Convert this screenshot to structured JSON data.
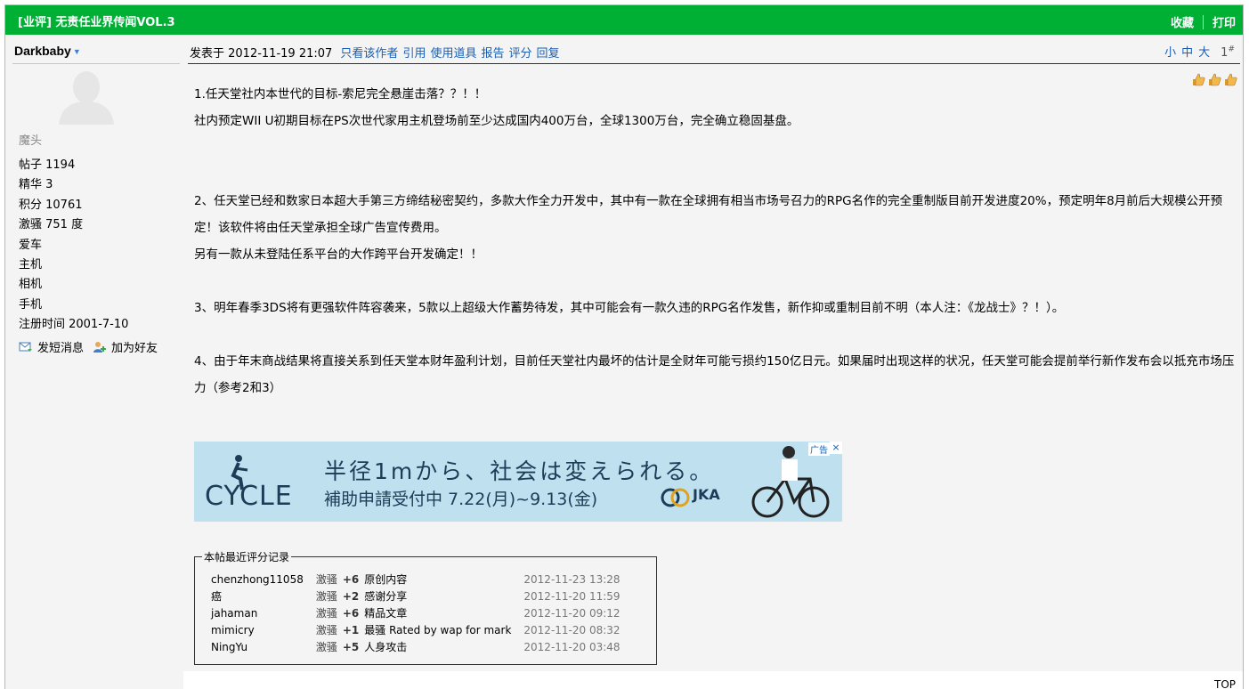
{
  "header": {
    "title": "[业评] 无责任业界传闻VOL.3",
    "favorite": "收藏",
    "print": "打印"
  },
  "author": {
    "name": "Darkbaby",
    "rank": "魔头",
    "stats": [
      "帖子 1194",
      "精华 3",
      "积分 10761",
      "激骚 751 度",
      "爱车",
      "主机",
      "相机",
      "手机",
      "注册时间 2001-7-10"
    ],
    "send_message": "发短消息",
    "add_friend": "加为好友"
  },
  "post_meta": {
    "posted": "发表于 2012-11-19 21:07",
    "links": [
      "只看该作者",
      "引用",
      "使用道具",
      "报告",
      "评分",
      "回复"
    ],
    "font_sizes": [
      "小",
      "中",
      "大"
    ],
    "floor": "1",
    "floor_mark": "#"
  },
  "post_body": [
    "1.任天堂社内本世代的目标-索尼完全悬崖击落？？！！",
    "社内预定WII U初期目标在PS次世代家用主机登场前至少达成国内400万台，全球1300万台，完全确立稳固基盘。",
    "",
    "",
    "2、任天堂已经和数家日本超大手第三方缔结秘密契约，多款大作全力开发中，其中有一款在全球拥有相当市场号召力的RPG名作的完全重制版目前开发进度20%，预定明年8月前后大规模公开预定！该软件将由任天堂承担全球广告宣传费用。",
    "另有一款从未登陆任系平台的大作跨平台开发确定！！",
    "",
    "3、明年春季3DS将有更强软件阵容袭来，5款以上超级大作蓄势待发，其中可能会有一款久违的RPG名作发售，新作抑或重制目前不明（本人注：《龙战士》？！）。",
    "",
    "4、由于年末商战结果将直接关系到任天堂本财年盈利计划，目前任天堂社内最坏的估计是全财年可能亏损约150亿日元。如果届时出现这样的状况，任天堂可能会提前举行新作发布会以抵充市场压力（参考2和3）"
  ],
  "ad": {
    "line1": "半径1mから、社会は変えられる。",
    "line2": "補助申請受付中 7.22(月)~9.13(金)",
    "brand": "CYCLE",
    "logo": "JKA",
    "label": "广告",
    "close": "×"
  },
  "ratings": {
    "legend": "本帖最近评分记录",
    "rows": [
      {
        "user": "chenzhong11058",
        "cat": "激骚",
        "val": "+6",
        "reason": "原创内容",
        "time": "2012-11-23 13:28"
      },
      {
        "user": "癌",
        "cat": "激骚",
        "val": "+2",
        "reason": "感谢分享",
        "time": "2012-11-20 11:59"
      },
      {
        "user": "jahaman",
        "cat": "激骚",
        "val": "+6",
        "reason": "精品文章",
        "time": "2012-11-20 09:12"
      },
      {
        "user": "mimicry",
        "cat": "激骚",
        "val": "+1",
        "reason": "最骚 Rated by wap for mark",
        "time": "2012-11-20 08:32"
      },
      {
        "user": "NingYu",
        "cat": "激骚",
        "val": "+5",
        "reason": "人身攻击",
        "time": "2012-11-20 03:48"
      }
    ]
  },
  "footer": {
    "top": "TOP"
  }
}
